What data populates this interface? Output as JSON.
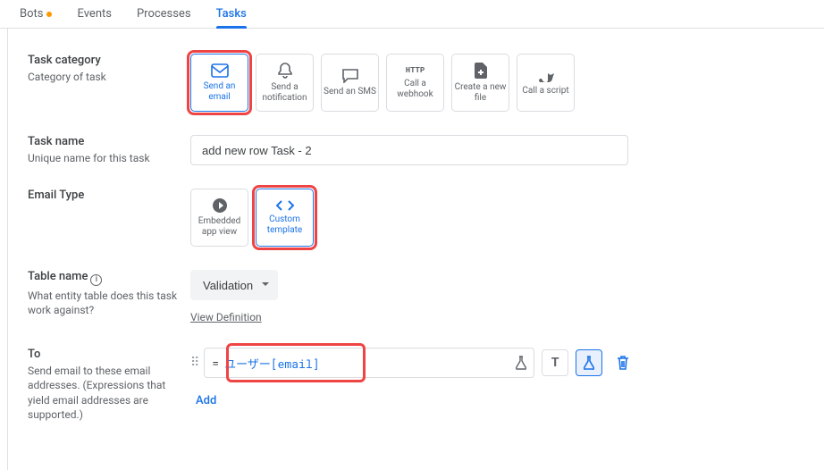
{
  "tabs": {
    "bots": "Bots",
    "events": "Events",
    "processes": "Processes",
    "tasks": "Tasks"
  },
  "task_category": {
    "label": "Task category",
    "desc": "Category of task",
    "options": {
      "send_email": "Send an email",
      "send_notification": "Send a notification",
      "send_sms": "Send an SMS",
      "call_webhook": "Call a webhook",
      "call_webhook_icon": "HTTP",
      "create_file": "Create a new file",
      "call_script": "Call a script"
    }
  },
  "task_name": {
    "label": "Task name",
    "desc": "Unique name for this task",
    "value": "add new row Task - 2"
  },
  "email_type": {
    "label": "Email Type",
    "options": {
      "embedded": "Embedded app view",
      "custom": "Custom template"
    }
  },
  "table_name": {
    "label": "Table name",
    "desc": "What entity table does this task work against?",
    "value": "Validation",
    "view_def": "View Definition"
  },
  "to": {
    "label": "To",
    "desc": "Send email to these email addresses. (Expressions that yield email addresses are supported.)",
    "eq": "=",
    "expr": "ユーザー[email]",
    "add": "Add"
  }
}
